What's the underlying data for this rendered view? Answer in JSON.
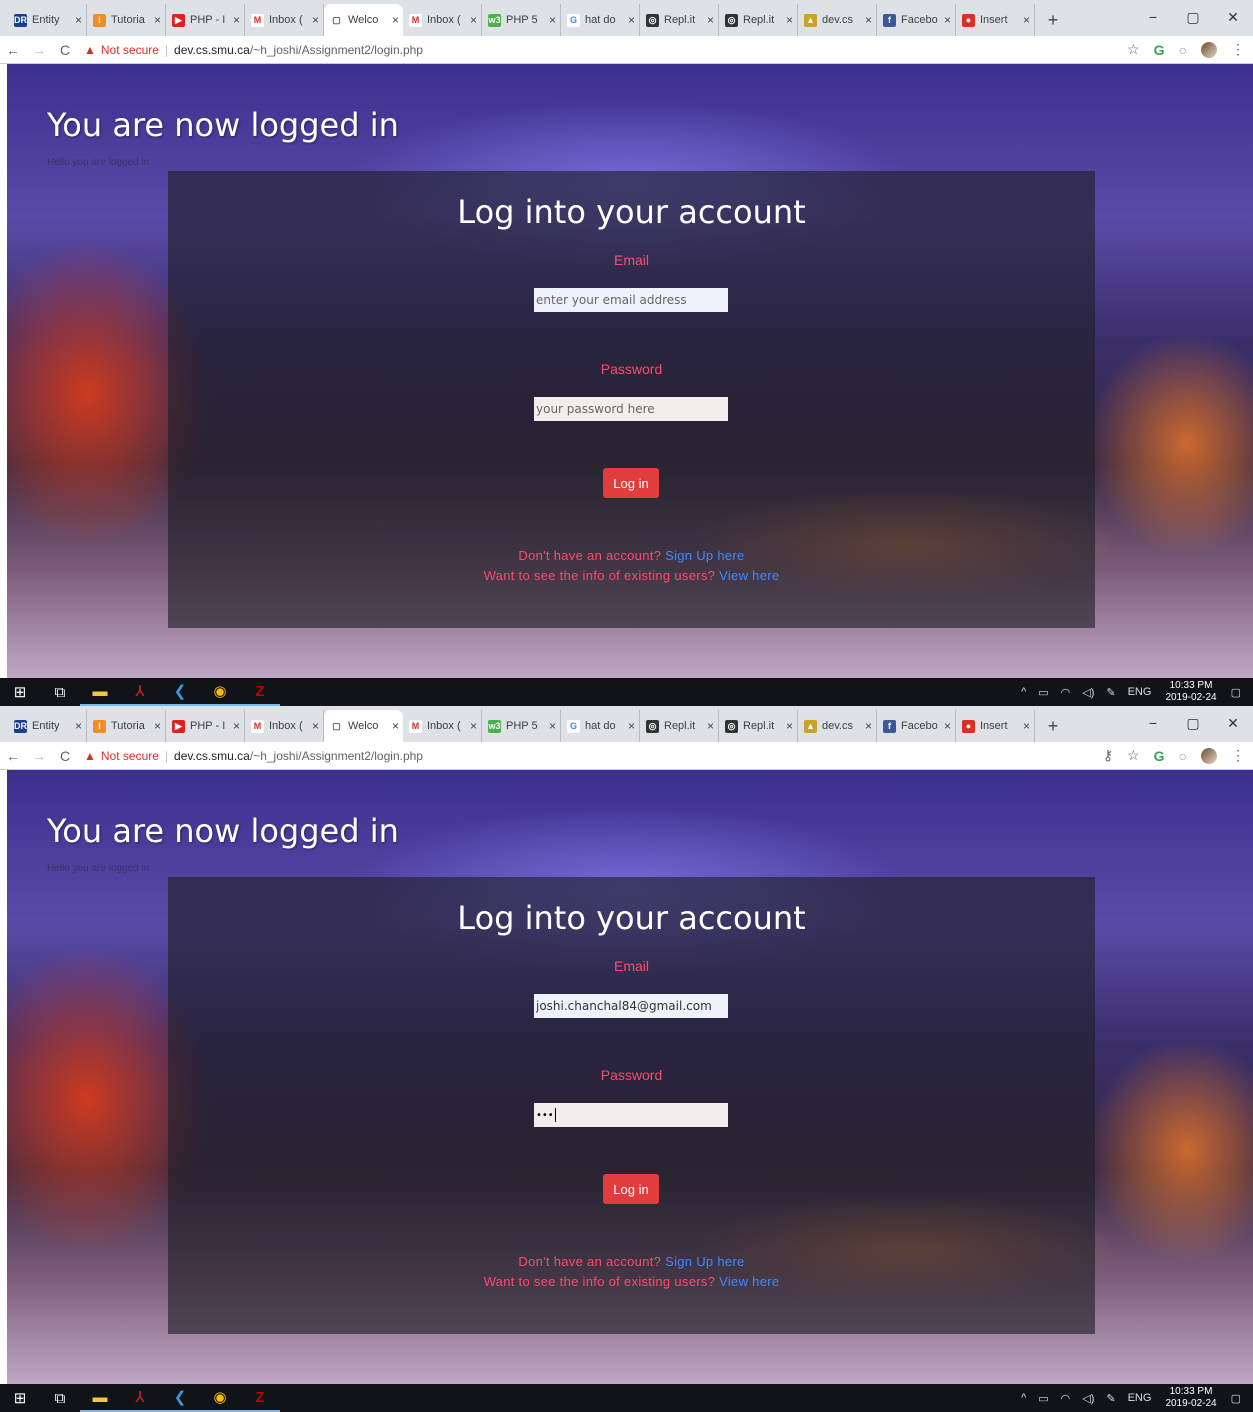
{
  "browser": {
    "tabs": [
      {
        "label": "Entity",
        "icon": "dr-icon",
        "color": "#1a3d8f",
        "glyph": "DR"
      },
      {
        "label": "Tutoria",
        "icon": "tutorial-icon",
        "color": "#f28c28",
        "glyph": "i"
      },
      {
        "label": "PHP - I",
        "icon": "youtube-icon",
        "color": "#e02020",
        "glyph": "▶"
      },
      {
        "label": "Inbox (",
        "icon": "gmail-icon",
        "color": "#ffffff",
        "glyph": "M"
      },
      {
        "label": "Welco",
        "icon": "page-icon",
        "color": "#ffffff",
        "glyph": "▢",
        "active": true
      },
      {
        "label": "Inbox (",
        "icon": "gmail-icon",
        "color": "#ffffff",
        "glyph": "M"
      },
      {
        "label": "PHP 5",
        "icon": "w3-icon",
        "color": "#4caf50",
        "glyph": "w3"
      },
      {
        "label": "hat do",
        "icon": "google-icon",
        "color": "#ffffff",
        "glyph": "G"
      },
      {
        "label": "Repl.it",
        "icon": "replit-icon",
        "color": "#333333",
        "glyph": "◎"
      },
      {
        "label": "Repl.it",
        "icon": "replit-icon",
        "color": "#333333",
        "glyph": "◎"
      },
      {
        "label": "dev.cs",
        "icon": "smu-icon",
        "color": "#c9a227",
        "glyph": "▲"
      },
      {
        "label": "Facebo",
        "icon": "facebook-icon",
        "color": "#3b5998",
        "glyph": "f"
      },
      {
        "label": "Insert",
        "icon": "insert-icon",
        "color": "#d93025",
        "glyph": "●"
      }
    ],
    "close_glyph": "×",
    "new_tab": "+",
    "win_min": "−",
    "win_max": "▢",
    "win_close": "✕",
    "not_secure": "Not secure",
    "url_host": "dev.cs.smu.ca",
    "url_path": "/~h_joshi/Assignment2/login.php"
  },
  "page": {
    "logged_in_text": "You are now logged in",
    "ghost_text": "Hello you are logged in",
    "title": "Log into your account",
    "email_label": "Email",
    "email_placeholder": "enter your email address",
    "password_label": "Password",
    "password_placeholder": "your password here",
    "login_button": "Log in",
    "no_account_text": "Don't have an account?",
    "signup_link": "Sign Up here",
    "existing_users_text": "Want to see the info of existing users?",
    "view_link": "View here"
  },
  "screen2": {
    "email_value": "joshi.chanchal84@gmail.com",
    "password_value": "•••"
  },
  "taskbar": {
    "lang": "ENG",
    "time": "10:33 PM",
    "date": "2019-02-24"
  }
}
